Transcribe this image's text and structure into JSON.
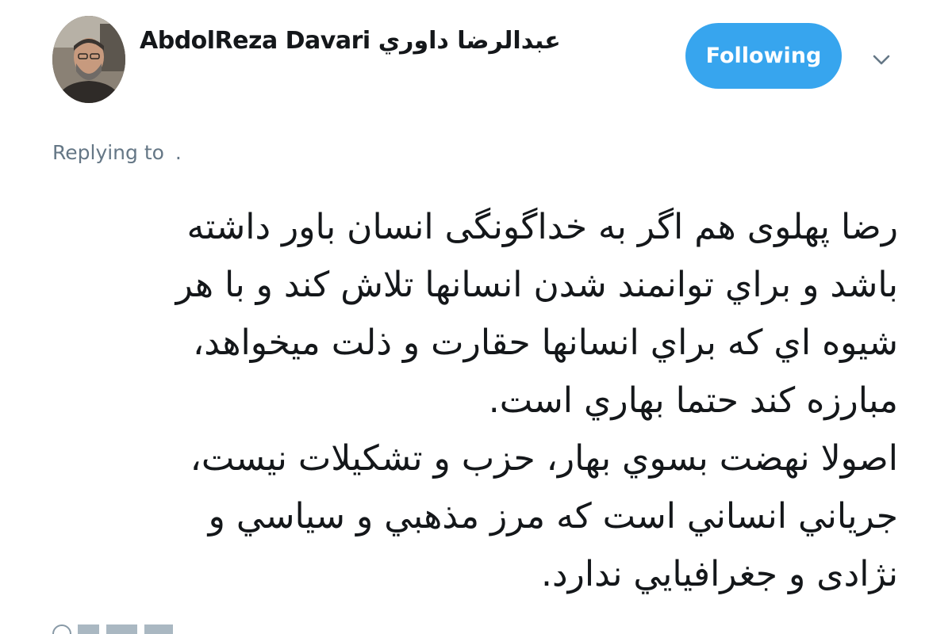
{
  "header": {
    "display_name_en": "AbdolReza Davari",
    "display_name_fa": "عبدالرضا داوري",
    "follow_button_label": "Following"
  },
  "reply": {
    "prefix": "Replying to",
    "target": "."
  },
  "tweet": {
    "lines": [
      "رضا پهلوی هم اگر به خداگونگی انسان باور داشته",
      "باشد و براي توانمند شدن انسانها تلاش کند و با هر",
      "شيوه اي که براي انسانها حقارت و ذلت ميخواهد،",
      "مبارزه کند حتما بهاري است.",
      "اصولا نهضت بسوي بهار، حزب و تشکيلات نيست،",
      "جرياني انساني است که مرز مذهبي و سياسي و",
      "نژادی و جغرافيايي ندارد."
    ]
  },
  "colors": {
    "accent": "#37a5ee",
    "text": "#14171a",
    "muted": "#657786"
  },
  "icons": {
    "menu": "chevron-down-icon",
    "avatar": "profile-photo"
  }
}
